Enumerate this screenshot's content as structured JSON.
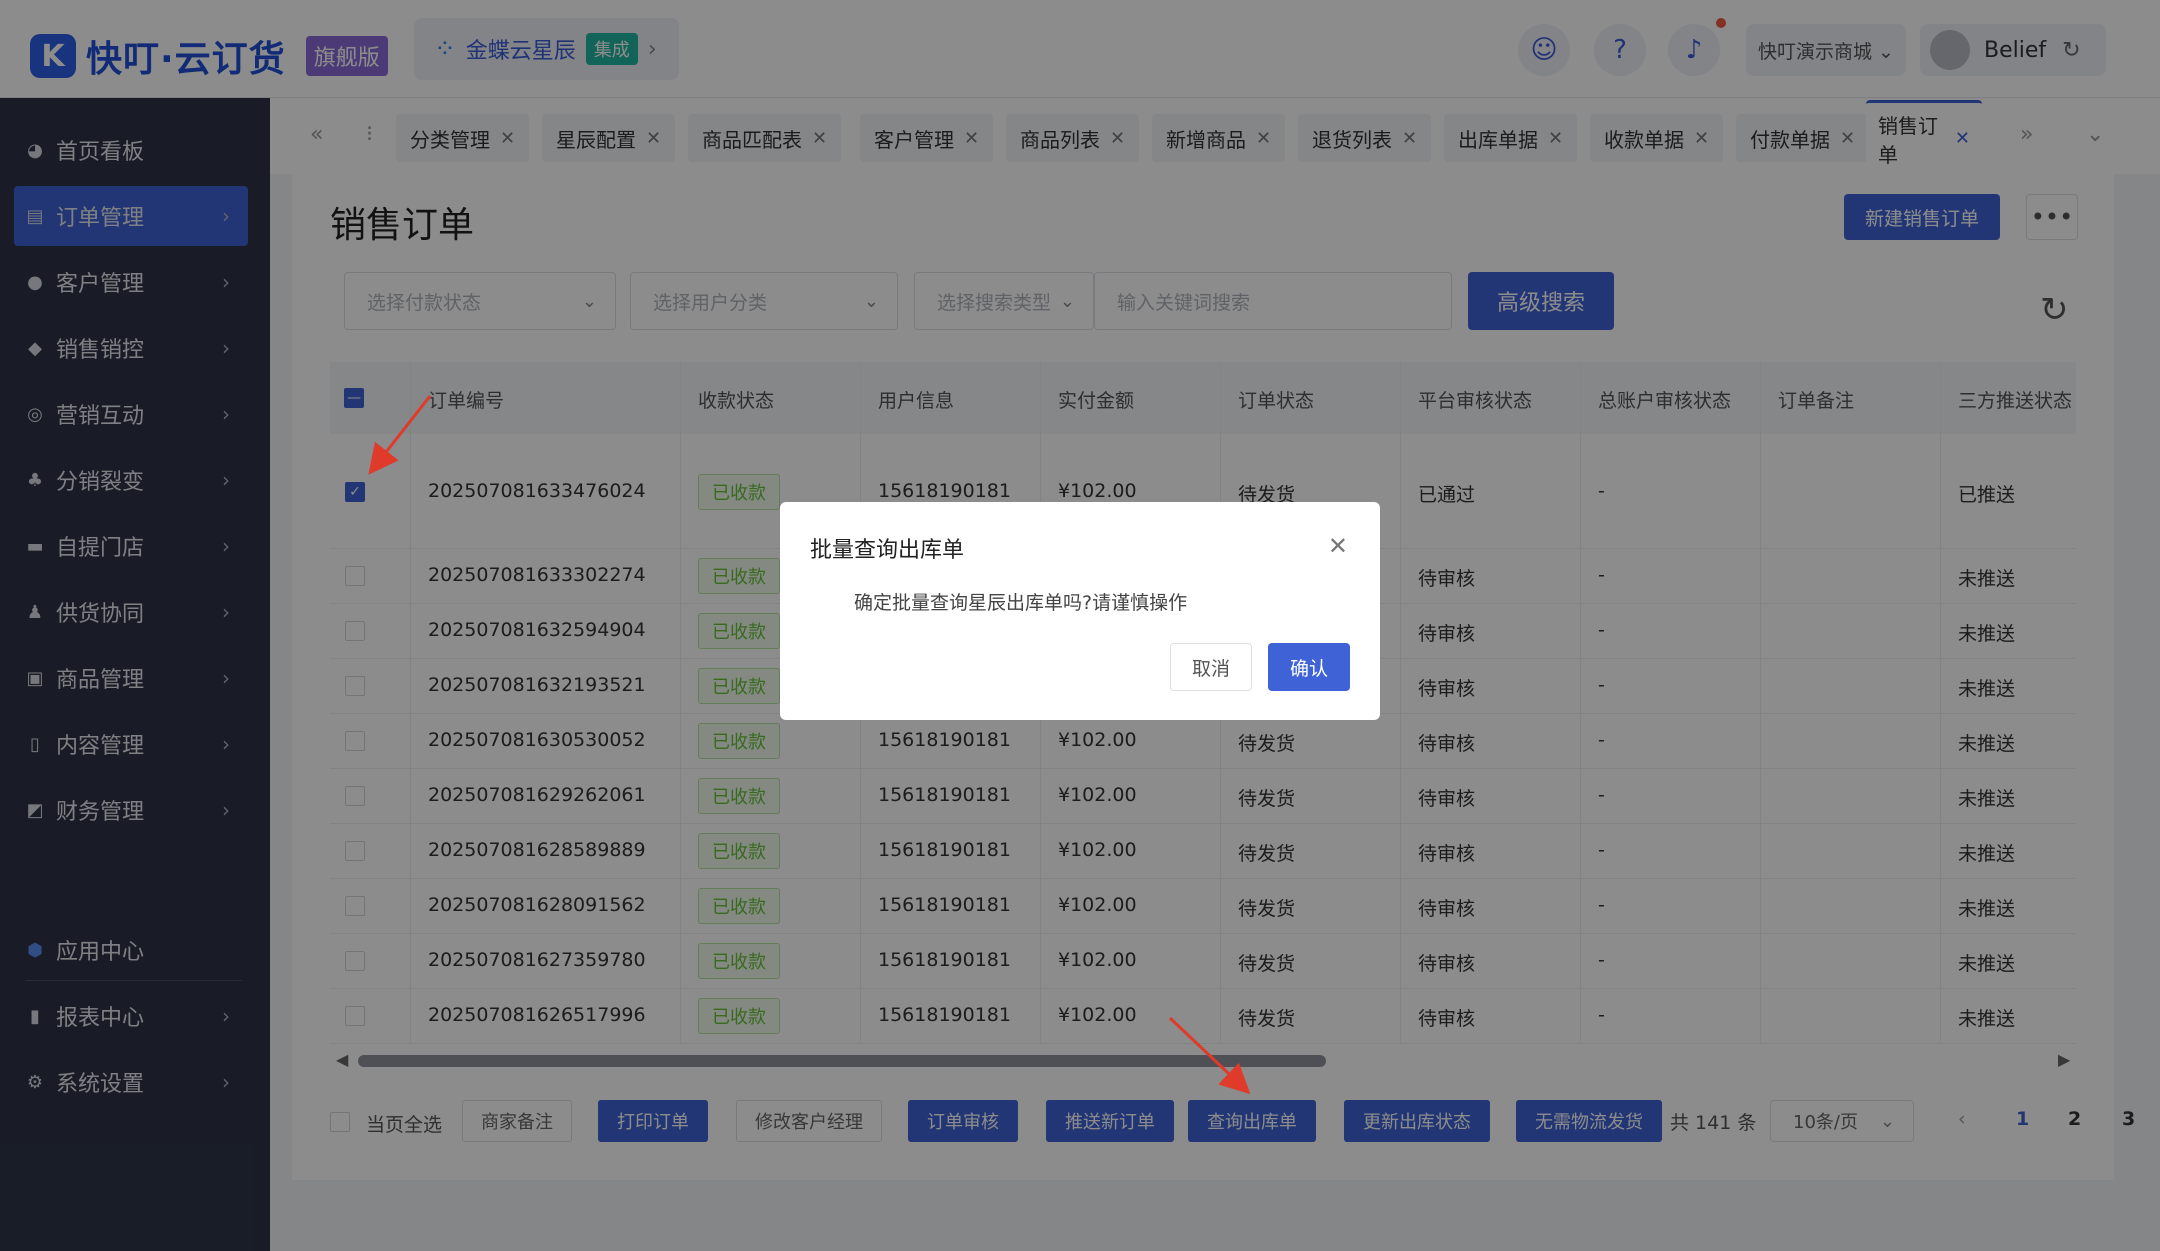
{
  "header": {
    "logo_mark": "K",
    "logo_text": "快叮·云订货",
    "edition_badge": "旗舰版",
    "integration_name": "金蝶云星辰",
    "integration_tag": "集成",
    "shop_name": "快叮演示商城 ⌄",
    "username": "Belief"
  },
  "sidebar": {
    "items": [
      {
        "label": "首页看板",
        "icon": "dashboard-icon"
      },
      {
        "label": "订单管理",
        "icon": "order-icon"
      },
      {
        "label": "客户管理",
        "icon": "customer-icon"
      },
      {
        "label": "销售销控",
        "icon": "tag-icon"
      },
      {
        "label": "营销互动",
        "icon": "marketing-icon"
      },
      {
        "label": "分销裂变",
        "icon": "tree-icon"
      },
      {
        "label": "自提门店",
        "icon": "store-icon"
      },
      {
        "label": "供货协同",
        "icon": "supply-icon"
      },
      {
        "label": "商品管理",
        "icon": "goods-icon"
      },
      {
        "label": "内容管理",
        "icon": "content-icon"
      },
      {
        "label": "财务管理",
        "icon": "wallet-icon"
      },
      {
        "label": "应用中心",
        "icon": "cube-icon"
      },
      {
        "label": "报表中心",
        "icon": "chart-icon"
      },
      {
        "label": "系统设置",
        "icon": "gear-icon"
      }
    ]
  },
  "tabs": [
    "分类管理",
    "星辰配置",
    "商品匹配表",
    "客户管理",
    "商品列表",
    "新增商品",
    "退货列表",
    "出库单据",
    "收款单据",
    "付款单据",
    "销售订单"
  ],
  "page": {
    "title": "销售订单",
    "new_button": "新建销售订单",
    "more": "•••"
  },
  "filters": {
    "pay_status": "选择付款状态",
    "user_category": "选择用户分类",
    "search_type": "选择搜索类型",
    "keyword_placeholder": "输入关键词搜索",
    "advanced_search": "高级搜索"
  },
  "table": {
    "headers": [
      "订单编号",
      "收款状态",
      "用户信息",
      "实付金额",
      "订单状态",
      "平台审核状态",
      "总账户审核状态",
      "订单备注",
      "三方推送状态"
    ],
    "rows": [
      {
        "id": "202507081633476024",
        "pay": "已收款",
        "user": "15618190181",
        "amount": "¥102.00",
        "status": "待发货",
        "audit": "已通过",
        "acc": "-",
        "note": "",
        "push": "已推送",
        "checked": true
      },
      {
        "id": "202507081633302274",
        "pay": "已收款",
        "user": "",
        "amount": "",
        "status": "",
        "audit": "待审核",
        "acc": "-",
        "note": "",
        "push": "未推送",
        "checked": false
      },
      {
        "id": "202507081632594904",
        "pay": "已收款",
        "user": "",
        "amount": "",
        "status": "",
        "audit": "待审核",
        "acc": "-",
        "note": "",
        "push": "未推送",
        "checked": false
      },
      {
        "id": "202507081632193521",
        "pay": "已收款",
        "user": "",
        "amount": "",
        "status": "",
        "audit": "待审核",
        "acc": "-",
        "note": "",
        "push": "未推送",
        "checked": false
      },
      {
        "id": "202507081630530052",
        "pay": "已收款",
        "user": "15618190181",
        "amount": "¥102.00",
        "status": "待发货",
        "audit": "待审核",
        "acc": "-",
        "note": "",
        "push": "未推送",
        "checked": false
      },
      {
        "id": "202507081629262061",
        "pay": "已收款",
        "user": "15618190181",
        "amount": "¥102.00",
        "status": "待发货",
        "audit": "待审核",
        "acc": "-",
        "note": "",
        "push": "未推送",
        "checked": false
      },
      {
        "id": "202507081628589889",
        "pay": "已收款",
        "user": "15618190181",
        "amount": "¥102.00",
        "status": "待发货",
        "audit": "待审核",
        "acc": "-",
        "note": "",
        "push": "未推送",
        "checked": false
      },
      {
        "id": "202507081628091562",
        "pay": "已收款",
        "user": "15618190181",
        "amount": "¥102.00",
        "status": "待发货",
        "audit": "待审核",
        "acc": "-",
        "note": "",
        "push": "未推送",
        "checked": false
      },
      {
        "id": "202507081627359780",
        "pay": "已收款",
        "user": "15618190181",
        "amount": "¥102.00",
        "status": "待发货",
        "audit": "待审核",
        "acc": "-",
        "note": "",
        "push": "未推送",
        "checked": false
      },
      {
        "id": "202507081626517996",
        "pay": "已收款",
        "user": "15618190181",
        "amount": "¥102.00",
        "status": "待发货",
        "audit": "待审核",
        "acc": "-",
        "note": "",
        "push": "未推送",
        "checked": false
      }
    ]
  },
  "footer": {
    "select_all": "当页全选",
    "buttons": [
      "商家备注",
      "打印订单",
      "修改客户经理",
      "订单审核",
      "推送新订单",
      "查询出库单",
      "更新出库状态",
      "无需物流发货"
    ],
    "total": "共 141 条",
    "page_size": "10条/页",
    "pages": [
      "1",
      "2",
      "3"
    ]
  },
  "modal": {
    "title": "批量查询出库单",
    "message": "确定批量查询星辰出库单吗?请谨慎操作",
    "cancel": "取消",
    "confirm": "确认"
  },
  "colors": {
    "primary": "#3f63d6",
    "sidebar_bg": "#2e3447",
    "success_green": "#67c23a",
    "arrow_red": "#e03a2a"
  }
}
